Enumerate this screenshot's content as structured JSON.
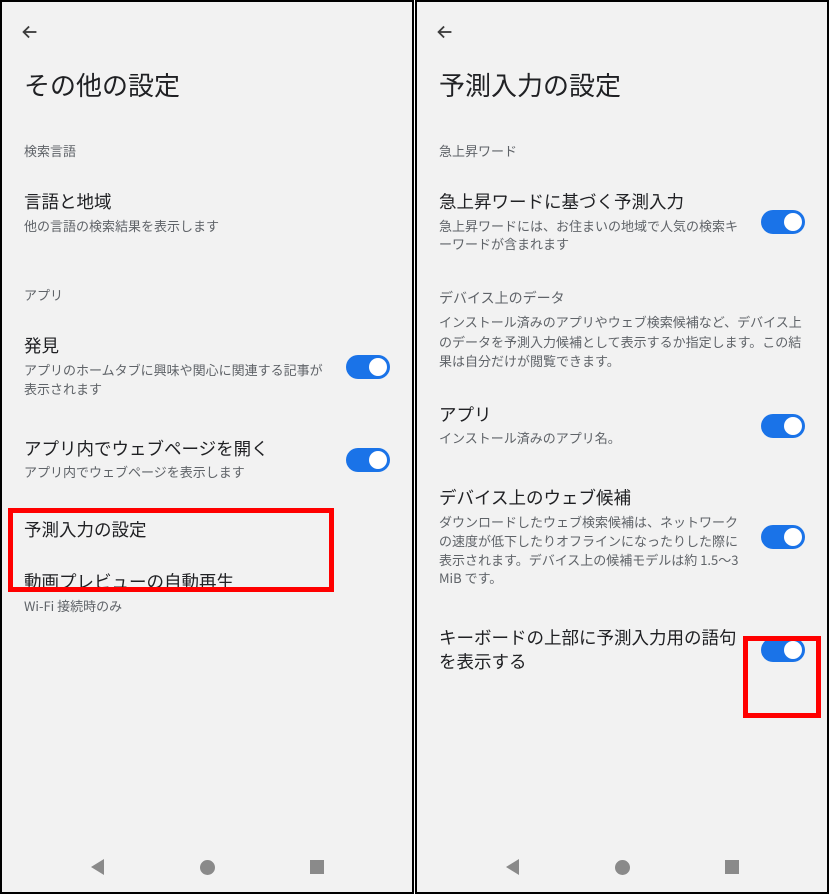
{
  "left": {
    "title": "その他の設定",
    "sections": {
      "search_lang": "検索言語",
      "apps": "アプリ"
    },
    "items": {
      "lang_region": {
        "title": "言語と地域",
        "sub": "他の言語の検索結果を表示します"
      },
      "discover": {
        "title": "発見",
        "sub": "アプリのホームタブに興味や関心に関連する記事が表示されます",
        "toggle": true
      },
      "open_in_app": {
        "title": "アプリ内でウェブページを開く",
        "sub": "アプリ内でウェブページを表示します",
        "toggle": true
      },
      "predictive": {
        "title": "予測入力の設定"
      },
      "video_preview": {
        "title": "動画プレビューの自動再生",
        "sub": "Wi-Fi 接続時のみ"
      }
    }
  },
  "right": {
    "title": "予測入力の設定",
    "sections": {
      "trending": "急上昇ワード"
    },
    "items": {
      "trending_predict": {
        "title": "急上昇ワードに基づく予測入力",
        "sub": "急上昇ワードには、お住まいの地域で人気の検索キーワードが含まれます",
        "toggle": true
      },
      "device_data_header": {
        "title": "デバイス上のデータ",
        "sub": "インストール済みのアプリやウェブ検索候補など、デバイス上のデータを予測入力候補として表示するか指定します。この結果は自分だけが閲覧できます。"
      },
      "apps": {
        "title": "アプリ",
        "sub": "インストール済みのアプリ名。",
        "toggle": true
      },
      "web_candidates": {
        "title": "デバイス上のウェブ候補",
        "sub": "ダウンロードしたウェブ検索候補は、ネットワークの速度が低下したりオフラインになったりした際に表示されます。デバイス上の候補モデルは約 1.5～3 MiB です。",
        "toggle": true
      },
      "keyboard_bar": {
        "title": "キーボードの上部に予測入力用の語句を表示する",
        "toggle": true
      }
    }
  },
  "highlight_color": "#ff0000",
  "toggle_color": "#1a73e8"
}
